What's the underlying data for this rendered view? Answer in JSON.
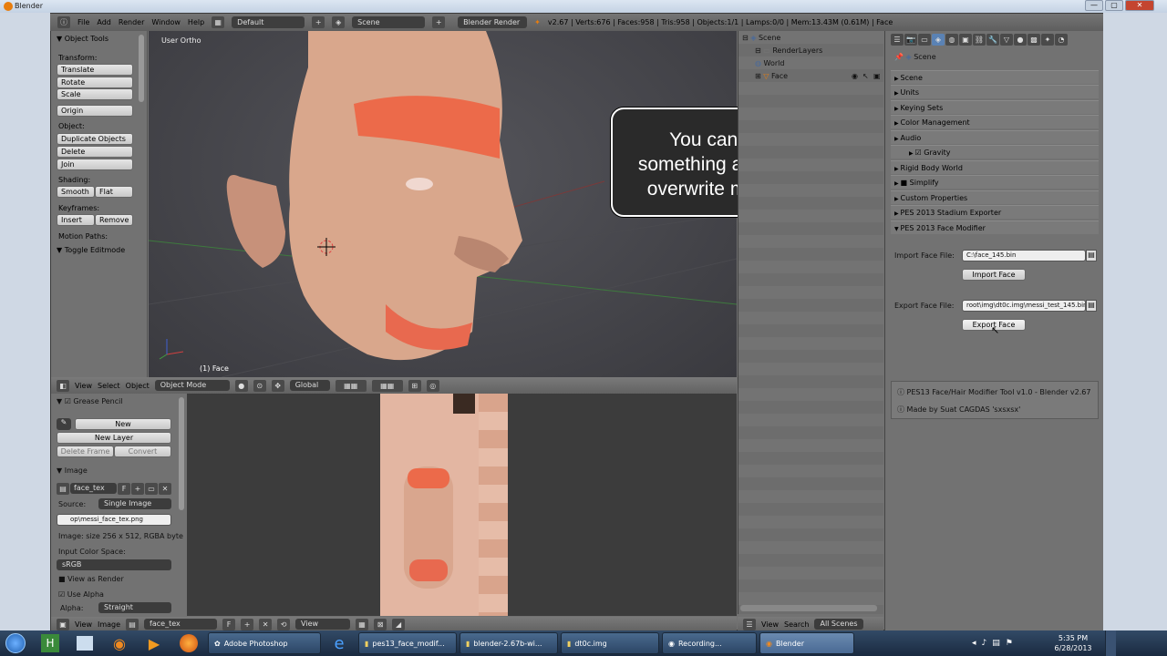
{
  "window": {
    "title": "Blender",
    "min": "—",
    "max": "▢",
    "close": "✕"
  },
  "topbar": {
    "menus": [
      "File",
      "Add",
      "Render",
      "Window",
      "Help"
    ],
    "layout": "Default",
    "scene": "Scene",
    "engine": "Blender Render",
    "stats": "v2.67 | Verts:676 | Faces:958 | Tris:958 | Objects:1/1 | Lamps:0/0 | Mem:13.43M (0.61M) | Face"
  },
  "toolshelf": {
    "header": "Object Tools",
    "transform_label": "Transform:",
    "translate": "Translate",
    "rotate": "Rotate",
    "scale": "Scale",
    "origin": "Origin",
    "object_label": "Object:",
    "duplicate": "Duplicate Objects",
    "delete": "Delete",
    "join": "Join",
    "shading_label": "Shading:",
    "smooth": "Smooth",
    "flat": "Flat",
    "keyframes_label": "Keyframes:",
    "insert": "Insert",
    "remove": "Remove",
    "motion_paths_label": "Motion Paths:",
    "toggle_editmode": "Toggle Editmode"
  },
  "viewport": {
    "view_label": "User Ortho",
    "object_label": "(1) Face",
    "header": {
      "view": "View",
      "select": "Select",
      "object": "Object",
      "mode": "Object Mode",
      "orientation": "Global"
    }
  },
  "callout": {
    "lines": [
      "You can change",
      "something and export it",
      "overwrite many times"
    ]
  },
  "outliner": {
    "items": [
      {
        "label": "Scene"
      },
      {
        "label": "RenderLayers"
      },
      {
        "label": "World"
      },
      {
        "label": "Face"
      }
    ],
    "footer": {
      "view": "View",
      "search": "Search",
      "filter": "All Scenes"
    }
  },
  "props": {
    "context": "Scene",
    "panels": [
      "Scene",
      "Units",
      "Keying Sets",
      "Color Management",
      "Audio",
      "Gravity",
      "Rigid Body World",
      "Simplify",
      "Custom Properties",
      "PES 2013 Stadium Exporter",
      "PES 2013 Face Modifier"
    ],
    "import_label": "Import Face File:",
    "import_value": "C:\\face_145.bin",
    "import_button": "Import Face",
    "export_label": "Export Face File:",
    "export_value": "root\\img\\dt0c.img\\messi_test_145.bin",
    "export_button": "Export Face",
    "info1": "PES13 Face/Hair Modifier Tool v1.0 - Blender v2.67",
    "info2": "Made by Suat CAGDAS 'sxsxsx'"
  },
  "imgpanel": {
    "grease_pencil": "Grease Pencil",
    "new": "New",
    "new_layer": "New Layer",
    "delete_frame": "Delete Frame",
    "convert": "Convert",
    "image_header": "Image",
    "image_name": "face_tex",
    "fake_user": "F",
    "source_label": "Source:",
    "source_value": "Single Image",
    "filepath": "op\\messi_face_tex.png",
    "image_size": "Image: size 256 x 512, RGBA byte",
    "input_color_space": "Input Color Space:",
    "color_space_value": "sRGB",
    "view_as_render": "View as Render",
    "use_alpha": "Use Alpha",
    "alpha_label": "Alpha:",
    "alpha_value": "Straight"
  },
  "imgfooter": {
    "view": "View",
    "image": "Image",
    "name": "face_tex",
    "fake": "F",
    "display": "View"
  },
  "taskbar": {
    "items": [
      {
        "label": "Adobe Photoshop"
      },
      {
        "label": "pes13_face_modif..."
      },
      {
        "label": "blender-2.67b-wi..."
      },
      {
        "label": "dt0c.img"
      },
      {
        "label": "Recording..."
      },
      {
        "label": "Blender"
      }
    ],
    "time": "5:35 PM",
    "date": "6/28/2013"
  }
}
